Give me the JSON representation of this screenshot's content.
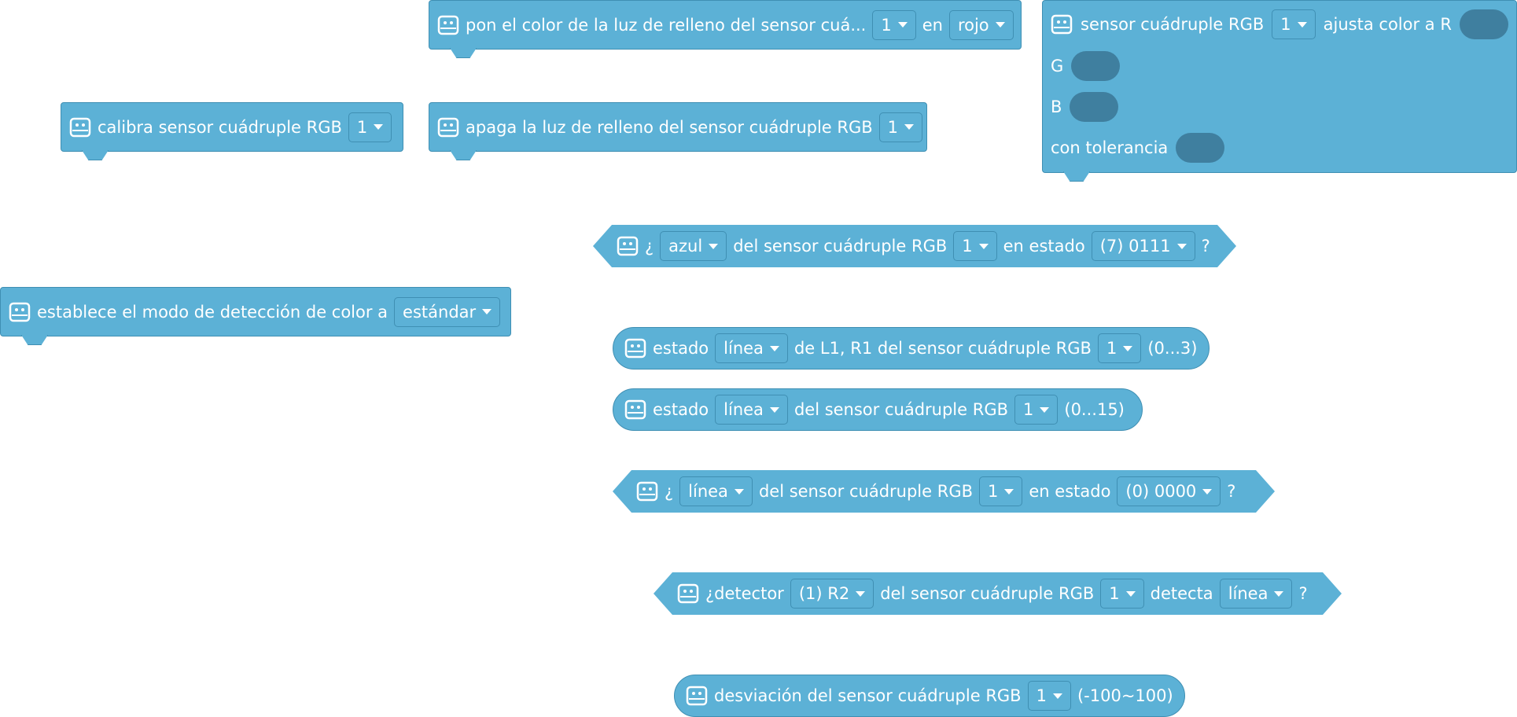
{
  "blocks": {
    "fill_light_color": {
      "text1": "pon el color de la luz de relleno del sensor cuá...",
      "port": "1",
      "text2": "en",
      "color": "rojo"
    },
    "calibrate": {
      "text1": "calibra sensor cuádruple RGB",
      "port": "1"
    },
    "fill_light_off": {
      "text1": "apaga la luz de relleno del sensor cuádruple RGB",
      "port": "1"
    },
    "rgb_adjust": {
      "text1": "sensor cuádruple RGB",
      "port": "1",
      "text2": "ajusta color a R",
      "g_label": "G",
      "b_label": "B",
      "tolerance_label": "con tolerancia"
    },
    "color_state": {
      "q_open": "¿",
      "color": "azul",
      "text1": "del sensor cuádruple RGB",
      "port": "1",
      "text2": "en estado",
      "state": "(7) 0111",
      "q_close": "?"
    },
    "detection_mode": {
      "text1": "establece el modo de detección de color a",
      "mode": "estándar"
    },
    "state_l1r1": {
      "text1": "estado",
      "kind": "línea",
      "text2": "de L1, R1 del sensor cuádruple RGB",
      "port": "1",
      "range": "(0...3)"
    },
    "state_all": {
      "text1": "estado",
      "kind": "línea",
      "text2": "del sensor cuádruple RGB",
      "port": "1",
      "range": "(0...15)"
    },
    "line_state": {
      "q_open": "¿",
      "kind": "línea",
      "text1": "del sensor cuádruple RGB",
      "port": "1",
      "text2": "en estado",
      "state": "(0) 0000",
      "q_close": "?"
    },
    "detector": {
      "text1": "¿detector",
      "probe": "(1) R2",
      "text2": "del sensor cuádruple RGB",
      "port": "1",
      "text3": "detecta",
      "kind": "línea",
      "q_close": "?"
    },
    "deviation": {
      "text1": "desviación del sensor cuádruple RGB",
      "port": "1",
      "range": "(-100~100)"
    }
  },
  "colors": {
    "block_fill": "#5cb1d6",
    "block_border": "#3f8fb3",
    "slot_fill": "#3f7f9f"
  },
  "icon": "sensor-icon"
}
